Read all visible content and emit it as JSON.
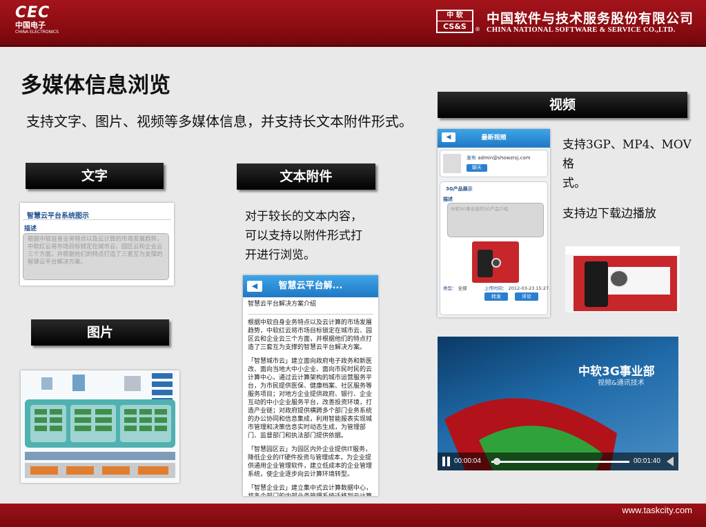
{
  "header": {
    "cec_logo": "CEC",
    "cec_cn": "中国电子",
    "cec_en": "CHINA ELECTRONICS",
    "css_logo_cn": "中 软",
    "css_logo_en": "CS&S",
    "reg_mark": "®",
    "company_cn": "中国软件与技术服务股份有限公司",
    "company_en": "CHINA NATIONAL SOFTWARE & SERVICE CO.,LTD."
  },
  "slide": {
    "title": "多媒体信息浏览",
    "description": "支持文字、图片、视频等多媒体信息，并支持长文本附件形式。"
  },
  "labels": {
    "text": "文字",
    "attachment": "文本附件",
    "image": "图片",
    "video": "视频"
  },
  "attachment_desc": [
    "对于较长的文本内容，",
    "可以支持以附件形式打",
    "开进行浏览。"
  ],
  "video_desc": {
    "formats": [
      "支持3GP、MP4、MOV格",
      "式。"
    ],
    "streaming": "支持边下载边播放"
  },
  "text_panel": {
    "title": "智慧云平台系统图示",
    "section": "描述",
    "body": "根据中软自身业务特点以及云计算的市场发展趋势，中软红云将市场目标锁定在城市云、园区云和企业云三个方面，并根据他们的特点打造了三套互为支撑的智慧云平台解决方案。"
  },
  "image_panel": {
    "left_label": "政府\n机关",
    "mid_label": "企业",
    "right_label": "政府",
    "bottom_label": "云计算服务平台",
    "service_pills": [
      "服务平台",
      "服务平台",
      "服务平台",
      "服务平台"
    ],
    "bottom_buttons": [
      "统一门户",
      "整合资源",
      "业务系统",
      "应用服务"
    ]
  },
  "doc_panel": {
    "bar_title": "智慧云平台解...",
    "back_icon": "◀",
    "heading": "智慧云平台解决方案介绍",
    "paragraphs": [
      "根据中软自身业务特点以及云计算的市场发展趋势，中软红云将市场目标锁定在城市云、园区云和企业云三个方面，并根据他们的特点打造了三套互为支撑的智慧云平台解决方案。",
      "「智慧城市云」建立面向政府电子政务和新医改、面向当地大中小企业、面向市民时民的云计算中心，通过云计算架构的城市运营服务平台，为市民提供医保、健康档案、社区服务等服务项目；对地方企业提供政府、银行、企业互动的中小企业服务平台，改善投资环境，打造产业链；对政府提供横跨多个部门业务系统的办公协同和信息集成，利用智能报表实现城市管理和决策信息实时动态生成，为管理部门、监督部门和执法部门提供依据。",
      "「智慧园区云」为园区内外企业提供IT服务，降低企业的IT硬件投资与管理成本，为企业提供通用企业管理软件，建立低成本的企业管理系统，使企业逐步向云计算环境转型。",
      "「智慧企业云」建立集中式云计算数据中心，将各个部门的内部业务管理系统迁移到云计算平台，并且基于云计算技术，整合企业内外的产业资源，打造一个为下属企业和合作企业服务的产业链云服务平台。"
    ]
  },
  "video_panel": {
    "bar_title": "最新视频",
    "back_icon": "◀",
    "publish_prefix": "发布",
    "publisher": "admin@showzrsj.com",
    "chat_button": "聊天",
    "section_title": "3G产品展示",
    "desc_label": "描述",
    "desc_text": "中软3G事业部的3G产品介绍",
    "type_label": "类型：",
    "type_value": "全部",
    "time_label": "上传时间：",
    "time_value": "2012-03-23 15:27...",
    "forward_button": "转发",
    "comment_button": "评论"
  },
  "player": {
    "title": "中软3G事业部",
    "subtitle": "视频&通讯技术",
    "current_time": "00:00:04",
    "total_time": "00:01:40",
    "progress": 0.04
  },
  "footer": {
    "site": "www.taskcity.com"
  },
  "colors": {
    "brand_red": "#8a0c12",
    "mobile_blue": "#1f78c4",
    "label_black": "#000000"
  }
}
